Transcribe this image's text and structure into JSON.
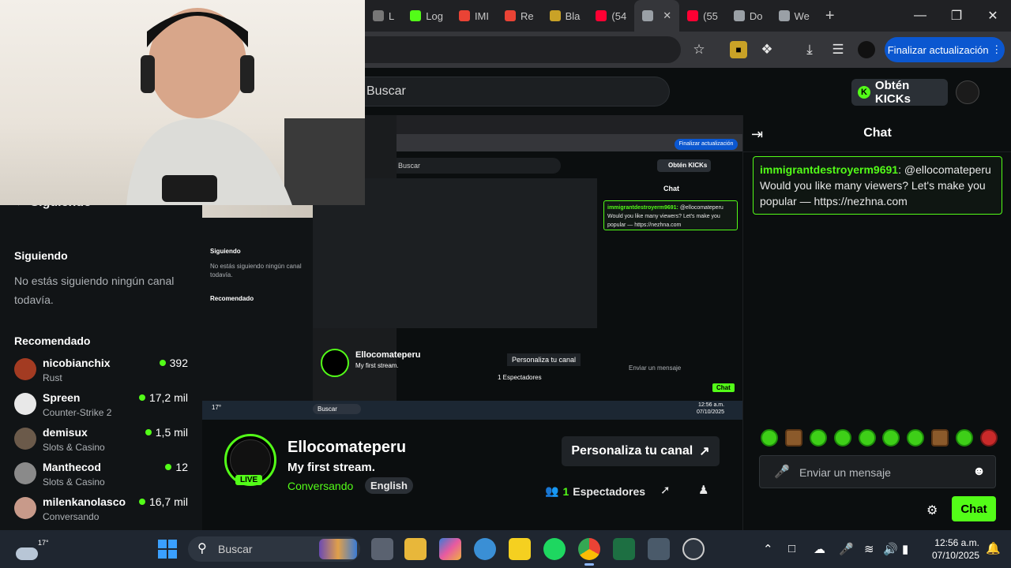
{
  "browser": {
    "tabs": [
      {
        "label": "L",
        "color": "#777777"
      },
      {
        "label": "Log",
        "color": "#53fc18"
      },
      {
        "label": "IMI",
        "color": "#ea4335"
      },
      {
        "label": "Re",
        "color": "#ea4335"
      },
      {
        "label": "Bla",
        "color": "#c9a227"
      },
      {
        "label": "(54",
        "color": "#ff0033"
      },
      {
        "label": "",
        "color": "#9aa0a6"
      },
      {
        "label": "(55",
        "color": "#ff0033"
      },
      {
        "label": "Do",
        "color": "#9aa0a6"
      },
      {
        "label": "We",
        "color": "#9aa0a6"
      }
    ],
    "new_tab": "+",
    "update_label": "Finalizar actualización"
  },
  "kick": {
    "search_placeholder": "Buscar",
    "kicks_label": "Obtén KICKs",
    "kicks_icon": "K"
  },
  "sidebar": {
    "collapse_label": "Siguiendo",
    "following_heading": "Siguiendo",
    "following_empty": "No estás siguiendo ningún canal todavía.",
    "recommended_heading": "Recomendado",
    "channels": [
      {
        "name": "nicobianchix",
        "category": "Rust",
        "viewers": "392",
        "color": "#a33b22"
      },
      {
        "name": "Spreen",
        "category": "Counter-Strike 2",
        "viewers": "17,2 mil",
        "color": "#e8e8e8"
      },
      {
        "name": "demisux",
        "category": "Slots & Casino",
        "viewers": "1,5 mil",
        "color": "#6b5a4a"
      },
      {
        "name": "Manthecod",
        "category": "Slots & Casino",
        "viewers": "12",
        "color": "#8a8a8a"
      },
      {
        "name": "milenkanolasco",
        "category": "Conversando",
        "viewers": "16,7 mil",
        "color": "#c89a8a"
      }
    ]
  },
  "player": {
    "mini_update": "Finalizar actualización",
    "mini_search": "Buscar",
    "mini_kicks": "Obtén KICKs",
    "mini_chat_title": "Chat",
    "mini_siguiendo": "Siguiendo",
    "mini_empty": "No estás siguiendo ningún canal todavía.",
    "mini_recomendado": "Recomendado",
    "mini_channel": "Ellocomateperu",
    "mini_title": "My first stream.",
    "mini_customize": "Personaliza tu canal",
    "mini_viewers": "1 Espectadores",
    "mini_input": "Enviar un mensaje",
    "mini_chat_btn": "Chat",
    "mini_msg_user": "immigrantdestroyerm9691:",
    "mini_msg_text": "@ellocomateperu Would you like many viewers? Let's make you popular — https://nezhna.com",
    "mini_taskbar_search": "Buscar",
    "mini_time": "12:56 a.m.",
    "mini_date": "07/10/2025",
    "mini_temp": "17°"
  },
  "channel": {
    "name": "Ellocomateperu",
    "title": "My first stream.",
    "category": "Conversando",
    "tag": "English",
    "live_label": "LIVE",
    "customize_label": "Personaliza tu canal",
    "viewers_count": "1",
    "viewers_label": "Espectadores"
  },
  "chat": {
    "title": "Chat",
    "message": {
      "user": "immigrantdestroyerm9691",
      "text": ": @ellocomateperu Would you like many viewers? Let's make you popular — https://nezhna.com"
    },
    "input_placeholder": "Enviar un mensaje",
    "send_label": "Chat"
  },
  "taskbar": {
    "temperature": "17°",
    "search_placeholder": "Buscar",
    "time": "12:56 a.m.",
    "date": "07/10/2025"
  }
}
